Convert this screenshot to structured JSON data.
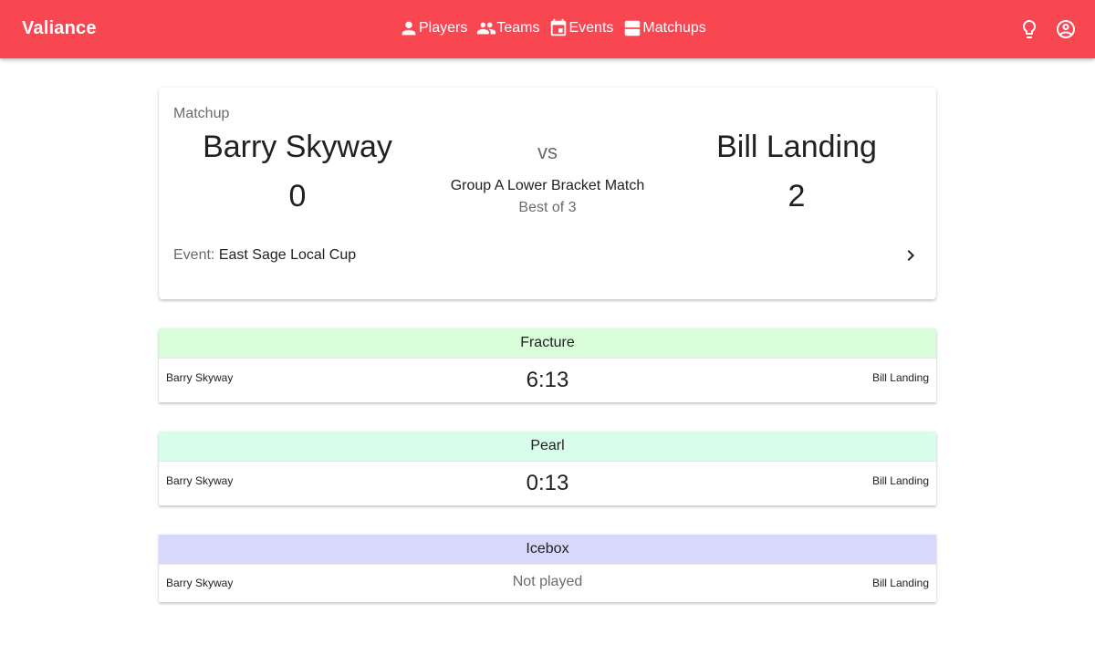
{
  "app": {
    "title": "Valiance"
  },
  "nav": [
    {
      "label": "Players",
      "icon": "person-icon"
    },
    {
      "label": "Teams",
      "icon": "people-icon"
    },
    {
      "label": "Events",
      "icon": "calendar-icon"
    },
    {
      "label": "Matchups",
      "icon": "matchups-icon"
    }
  ],
  "appbar_icons": [
    "lightbulb-icon",
    "account-circle-icon"
  ],
  "matchup": {
    "label": "Matchup",
    "team1": {
      "name": "Barry Skyway",
      "score": "0"
    },
    "team2": {
      "name": "Bill Landing",
      "score": "2"
    },
    "vs": "vs",
    "stage": "Group A Lower Bracket Match",
    "best_of": "Best of 3",
    "event_label": "Event:",
    "event_name": "East Sage Local Cup"
  },
  "maps": [
    {
      "name": "Fracture",
      "left": "Barry Skyway",
      "right": "Bill Landing",
      "result": "6:13",
      "played": true,
      "color": "#d8fdd8"
    },
    {
      "name": "Pearl",
      "left": "Barry Skyway",
      "right": "Bill Landing",
      "result": "0:13",
      "played": true,
      "color": "#d8fdea"
    },
    {
      "name": "Icebox",
      "left": "Barry Skyway",
      "right": "Bill Landing",
      "result": "Not played",
      "played": false,
      "color": "#d8d8fa"
    }
  ],
  "colors": {
    "appbar": "#f94752",
    "muted_text": "#6b6b6b"
  }
}
